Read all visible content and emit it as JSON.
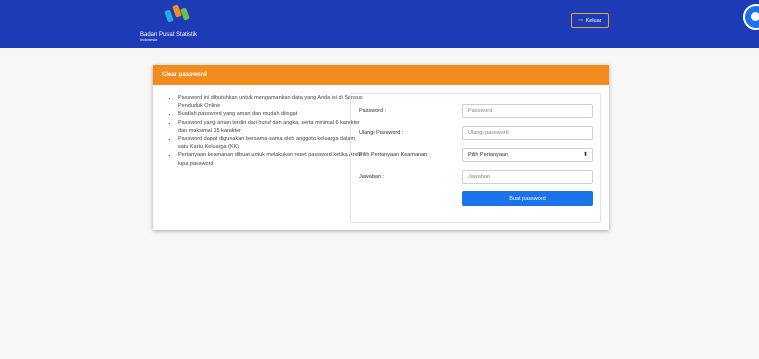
{
  "header": {
    "brand_name": "Badan Pusat Statistik",
    "brand_sub": "Indonesia",
    "logout_label": "Keluar",
    "logout_icon": "logout-icon",
    "background_color": "#1d3bb4",
    "chat_icon": "chat-icon"
  },
  "card": {
    "title": "Clear password",
    "header_color": "#f28c1e",
    "info_items": [
      "Password ini dibutuhkan untuk mengamankan data yang Anda isi di Sensus Penduduk Online",
      "Buatlah password yang aman dan mudah diingat",
      "Password yang aman terdiri dari huruf dan angka, serta minimal 6 karakter dan maksimal 15 karakter",
      "Password dapat digunakan bersama-sama oleh anggota keluarga dalam satu Kartu Keluarga (KK)",
      "Pertanyaan keamanan dibuat untuk melakukan reset password ketika Anda lupa password"
    ]
  },
  "form": {
    "password_label": "Password :",
    "password_placeholder": "Password",
    "repeat_label": "Ulangi Password :",
    "repeat_placeholder": "Ulangi password",
    "question_label": "Pilih Pertanyaan Keamanan :",
    "question_selected": "Pilih Pertanyaan",
    "answer_label": "Jawaban :",
    "answer_placeholder": "Jawaban",
    "submit_label": "Buat password",
    "submit_color": "#1a73e8"
  }
}
